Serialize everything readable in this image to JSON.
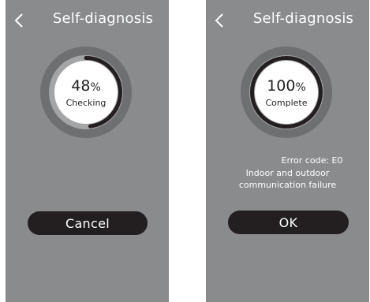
{
  "colors": {
    "screen_bg": "#8a8b8d",
    "ring_outer": "#6e6f71",
    "ring_inner": "#a4a5a7",
    "progress": "#231f20",
    "dial_face": "#ffffff",
    "button": "#231f20",
    "text_light": "#ffffff",
    "text_dark": "#231f20"
  },
  "screens": [
    {
      "back_icon": "chevron-left-icon",
      "title": "Self-diagnosis",
      "progress": {
        "value": "48",
        "unit": "%",
        "fraction": 0.48,
        "status": "Checking"
      },
      "button_label": "Cancel"
    },
    {
      "back_icon": "chevron-left-icon",
      "title": "Self-diagnosis",
      "progress": {
        "value": "100",
        "unit": "%",
        "fraction": 1.0,
        "status": "Complete"
      },
      "error": {
        "code": "Error code:  E0",
        "line1": "Indoor and outdoor",
        "line2": "communication failure"
      },
      "button_label": "OK"
    }
  ]
}
